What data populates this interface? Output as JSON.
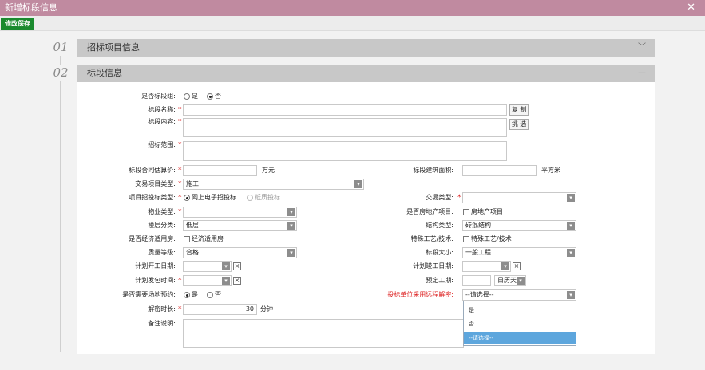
{
  "window": {
    "title": "新增标段信息",
    "close": "✕"
  },
  "toolbar": {
    "save": "修改保存"
  },
  "sections": [
    {
      "num": "01",
      "title": "招标项目信息",
      "chevron": "﹀"
    },
    {
      "num": "02",
      "title": "标段信息",
      "chevron": "—"
    }
  ],
  "form": {
    "is_group": {
      "label": "是否标段组:",
      "yes": "是",
      "no": "否"
    },
    "name": {
      "label": "标段名称:",
      "copy": "复 制"
    },
    "content": {
      "label": "标段内容:",
      "pick": "挑 选"
    },
    "scope": {
      "label": "招标范围:"
    },
    "estimate": {
      "label": "标段合同估算价:",
      "unit": "万元"
    },
    "area": {
      "label": "标段建筑面积:",
      "unit": "平方米"
    },
    "deal_proj_type": {
      "label": "交易项目类型:",
      "value": "施工"
    },
    "bid_type": {
      "label": "项目招投标类型:",
      "online": "网上电子招投标",
      "paper": "纸质投标"
    },
    "deal_type": {
      "label": "交易类型:",
      "value": ""
    },
    "property_type": {
      "label": "物业类型:",
      "value": ""
    },
    "realestate": {
      "label": "是否房地产项目:",
      "check": "房地产项目"
    },
    "floor_class": {
      "label": "楼层分类:",
      "value": "低层"
    },
    "structure": {
      "label": "结构类型:",
      "value": "砖混结构"
    },
    "econ_house": {
      "label": "是否经济适用房:",
      "check": "经济适用房"
    },
    "special_tech": {
      "label": "特殊工艺/技术:",
      "check": "特殊工艺/技术"
    },
    "quality": {
      "label": "质量等级:",
      "value": "合格"
    },
    "size": {
      "label": "标段大小:",
      "value": "一般工程"
    },
    "start_date": {
      "label": "计划开工日期:"
    },
    "finish_date": {
      "label": "计划竣工日期:"
    },
    "release_time": {
      "label": "计划发包时间:"
    },
    "duration": {
      "label": "预定工期:",
      "unit": "日历天"
    },
    "venue": {
      "label": "是否需要场地预约:",
      "yes": "是",
      "no": "否"
    },
    "remote_decrypt": {
      "label": "投标单位采用远程解密:",
      "value": "--请选择--"
    },
    "decrypt_time": {
      "label": "解密时长:",
      "value": "30",
      "unit": "分钟"
    },
    "remark": {
      "label": "备注说明:"
    }
  },
  "dropdown": {
    "options": [
      "是",
      "否",
      "--请选择--"
    ]
  }
}
